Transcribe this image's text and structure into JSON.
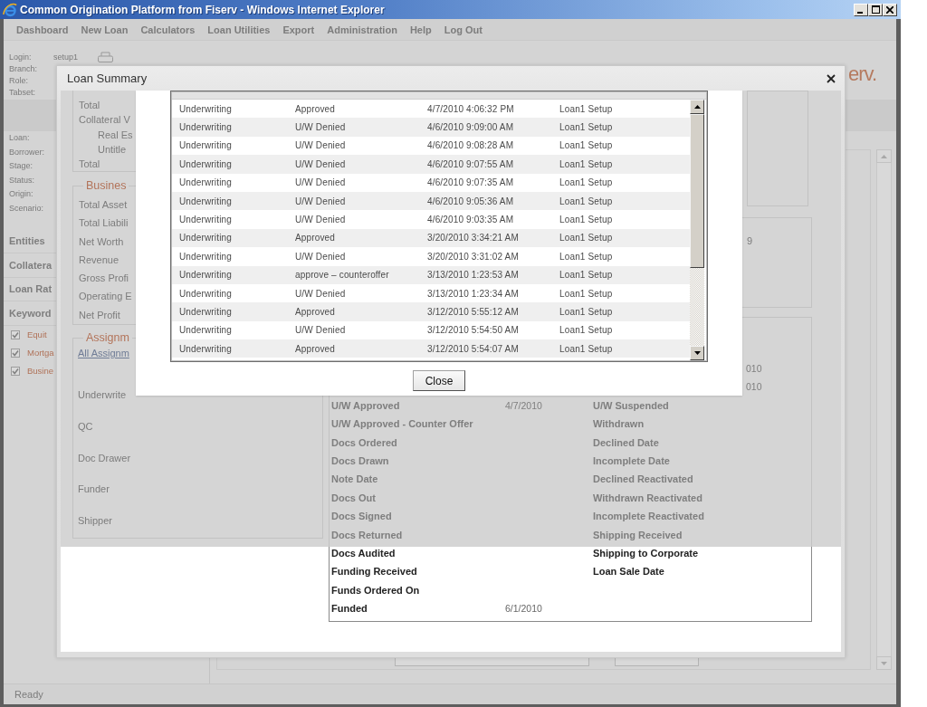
{
  "window": {
    "title": "Common Origination Platform from Fiserv - Windows Internet Explorer"
  },
  "menu": [
    "Dashboard",
    "New Loan",
    "Calculators",
    "Loan Utilities",
    "Export",
    "Administration",
    "Help",
    "Log Out"
  ],
  "user_info": [
    {
      "label": "Login:",
      "value": "setup1"
    },
    {
      "label": "Branch:"
    },
    {
      "label": "Role:"
    },
    {
      "label": "Tabset:"
    }
  ],
  "logo": {
    "text": "erv."
  },
  "loan_fields": [
    "Loan:",
    "Borrower:",
    "Stage:",
    "Status:",
    "Origin:",
    "Scenario:"
  ],
  "sidebar_sections": [
    "Entities",
    "Collatera",
    "Loan Rat",
    "Keyword"
  ],
  "keyword_filters": [
    {
      "label": "Equit",
      "checked": true
    },
    {
      "label": "Mortga",
      "checked": true
    },
    {
      "label": "Busine",
      "checked": true
    }
  ],
  "loan_summary": {
    "title": "Loan Summary",
    "fieldsets": [
      {
        "kind": "compact",
        "items": [
          {
            "label": "Total"
          },
          {
            "label": "Collateral V",
            "children": [
              {
                "label": "Real Es"
              },
              {
                "label": "Untitle"
              }
            ]
          },
          {
            "label": "Total"
          }
        ]
      },
      {
        "kind": "list",
        "legend": "Busines",
        "items": [
          {
            "label": "Total Asset"
          },
          {
            "label": "Total Liabili"
          },
          {
            "label": "Net Worth"
          },
          {
            "label": "Revenue"
          },
          {
            "label": "Gross Profi"
          },
          {
            "label": "Operating E"
          },
          {
            "label": "Net Profit"
          }
        ]
      },
      {
        "kind": "fields",
        "legend": "Assignm",
        "link": "All Assignm",
        "items": [
          {
            "label": "Underwrite"
          },
          {
            "label": "QC"
          },
          {
            "label": "Doc Drawer"
          },
          {
            "label": "Funder"
          },
          {
            "label": "Shipper"
          }
        ]
      }
    ],
    "status_fragment": "9",
    "milestones": [
      {
        "date_2": "010",
        "dimmed": true
      },
      {
        "date_2": "010",
        "dimmed": true
      },
      {
        "label": "U/W Approved",
        "date": "4/7/2010",
        "label_2": "U/W Suspended",
        "dimmed": true
      },
      {
        "label": "U/W Approved - Counter Offer",
        "label_2": "Withdrawn",
        "dimmed": true
      },
      {
        "label": "Docs Ordered",
        "label_2": "Declined Date",
        "dimmed": true
      },
      {
        "label": "Docs Drawn",
        "label_2": "Incomplete Date",
        "dimmed": true
      },
      {
        "label": "Note Date",
        "label_2": "Declined Reactivated",
        "dimmed": true
      },
      {
        "label": "Docs Out",
        "label_2": "Withdrawn Reactivated",
        "dimmed": true
      },
      {
        "label": "Docs Signed",
        "label_2": "Incomplete Reactivated",
        "dimmed": true
      },
      {
        "label": "Docs Returned",
        "label_2": "Shipping Received",
        "dimmed": true
      },
      {
        "label": "Docs Audited",
        "label_2": "Shipping to Corporate",
        "dimmed": false
      },
      {
        "label": "Funding Received",
        "label_2": "Loan Sale Date",
        "dimmed": false
      },
      {
        "label": "Funds Ordered On",
        "dimmed": false
      },
      {
        "label": "Funded",
        "date": "6/1/2010",
        "dimmed": false
      }
    ],
    "history": {
      "rows": [
        {
          "stage": "Underwriting",
          "action": "Approved",
          "date": "4/7/2010 4:06:32 PM",
          "user": "Loan1 Setup"
        },
        {
          "stage": "Underwriting",
          "action": "U/W Denied",
          "date": "4/6/2010 9:09:00 AM",
          "user": "Loan1 Setup"
        },
        {
          "stage": "Underwriting",
          "action": "U/W Denied",
          "date": "4/6/2010 9:08:28 AM",
          "user": "Loan1 Setup"
        },
        {
          "stage": "Underwriting",
          "action": "U/W Denied",
          "date": "4/6/2010 9:07:55 AM",
          "user": "Loan1 Setup"
        },
        {
          "stage": "Underwriting",
          "action": "U/W Denied",
          "date": "4/6/2010 9:07:35 AM",
          "user": "Loan1 Setup"
        },
        {
          "stage": "Underwriting",
          "action": "U/W Denied",
          "date": "4/6/2010 9:05:36 AM",
          "user": "Loan1 Setup"
        },
        {
          "stage": "Underwriting",
          "action": "U/W Denied",
          "date": "4/6/2010 9:03:35 AM",
          "user": "Loan1 Setup"
        },
        {
          "stage": "Underwriting",
          "action": "Approved",
          "date": "3/20/2010 3:34:21 AM",
          "user": "Loan1 Setup"
        },
        {
          "stage": "Underwriting",
          "action": "U/W Denied",
          "date": "3/20/2010 3:31:02 AM",
          "user": "Loan1 Setup"
        },
        {
          "stage": "Underwriting",
          "action": "approve – counteroffer",
          "date": "3/13/2010 1:23:53 AM",
          "user": "Loan1 Setup"
        },
        {
          "stage": "Underwriting",
          "action": "U/W Denied",
          "date": "3/13/2010 1:23:34 AM",
          "user": "Loan1 Setup"
        },
        {
          "stage": "Underwriting",
          "action": "Approved",
          "date": "3/12/2010 5:55:12 AM",
          "user": "Loan1 Setup"
        },
        {
          "stage": "Underwriting",
          "action": "U/W Denied",
          "date": "3/12/2010 5:54:50 AM",
          "user": "Loan1 Setup"
        },
        {
          "stage": "Underwriting",
          "action": "Approved",
          "date": "3/12/2010 5:54:07 AM",
          "user": "Loan1 Setup"
        }
      ],
      "close_button": "Close"
    }
  },
  "status_bar": {
    "text": "Ready"
  }
}
